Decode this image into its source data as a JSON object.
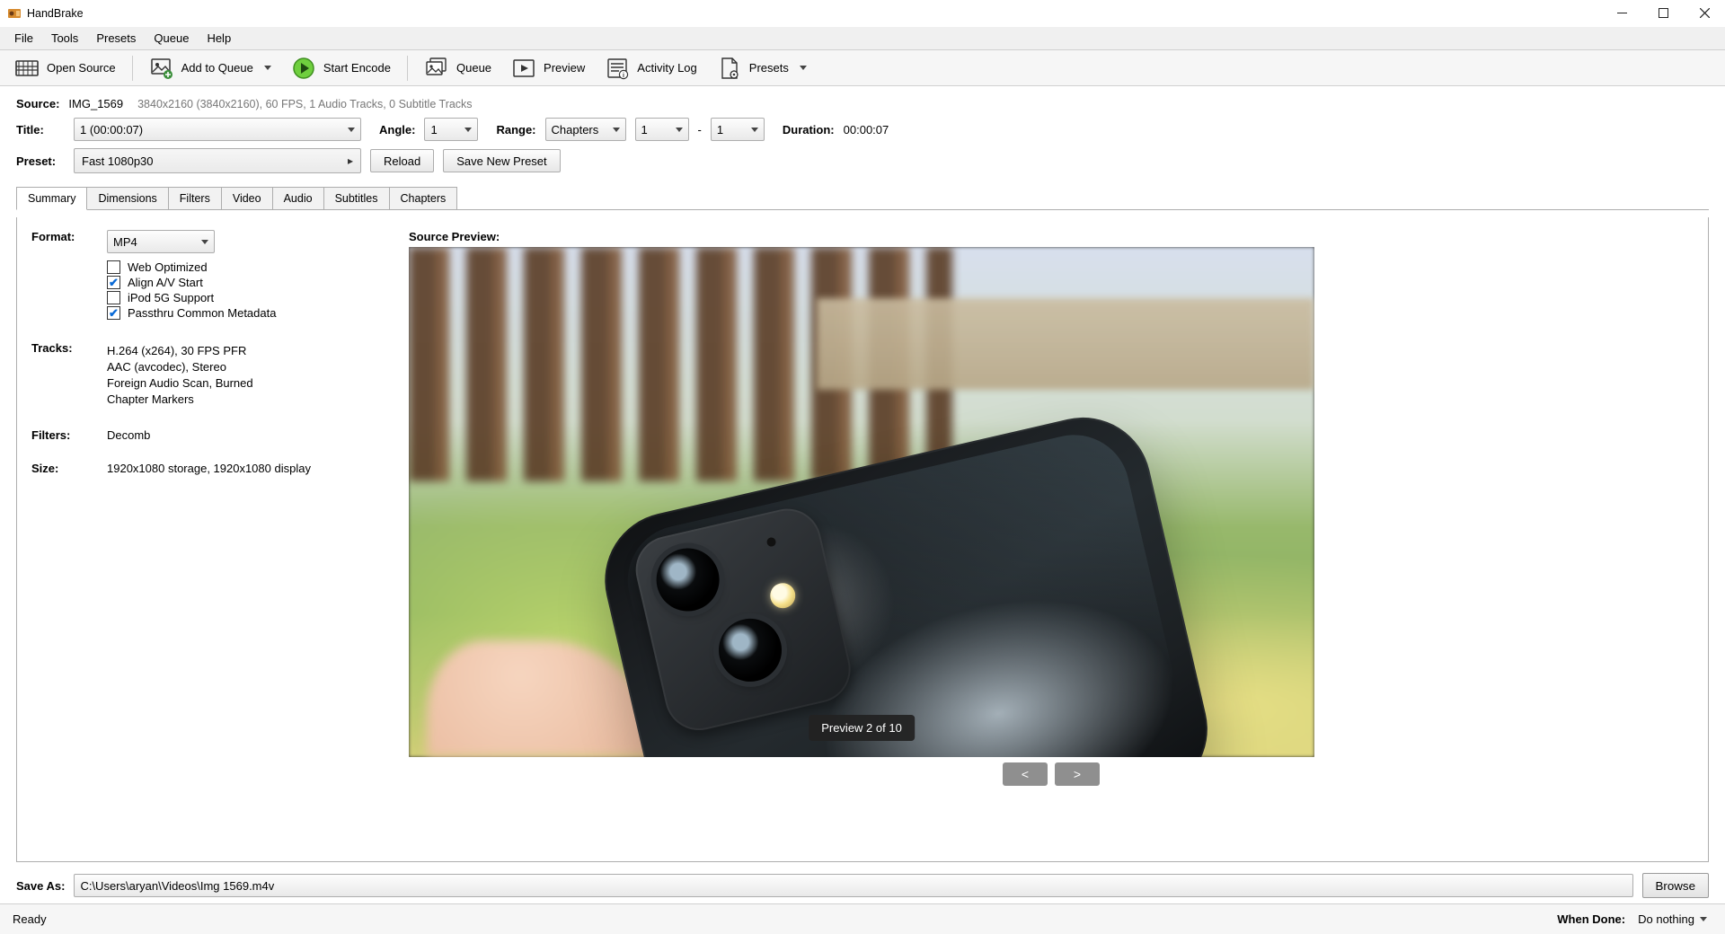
{
  "app": {
    "name": "HandBrake"
  },
  "menubar": {
    "items": [
      "File",
      "Tools",
      "Presets",
      "Queue",
      "Help"
    ]
  },
  "toolbar": {
    "open_source": "Open Source",
    "add_to_queue": "Add to Queue",
    "start_encode": "Start Encode",
    "queue": "Queue",
    "preview": "Preview",
    "activity_log": "Activity Log",
    "presets": "Presets"
  },
  "source_row": {
    "label": "Source:",
    "source_name": "IMG_1569",
    "source_info": "3840x2160 (3840x2160), 60 FPS, 1 Audio Tracks, 0 Subtitle Tracks"
  },
  "title_row": {
    "title_label": "Title:",
    "title_value": "1  (00:00:07)",
    "angle_label": "Angle:",
    "angle_value": "1",
    "range_label": "Range:",
    "range_type": "Chapters",
    "range_from": "1",
    "range_sep": "-",
    "range_to": "1",
    "duration_label": "Duration:",
    "duration_value": "00:00:07"
  },
  "preset_row": {
    "preset_label": "Preset:",
    "preset_value": "Fast 1080p30",
    "reload": "Reload",
    "save_new": "Save New Preset"
  },
  "tabs": {
    "items": [
      "Summary",
      "Dimensions",
      "Filters",
      "Video",
      "Audio",
      "Subtitles",
      "Chapters"
    ],
    "active_index": 0
  },
  "summary": {
    "format_label": "Format:",
    "format_value": "MP4",
    "options": {
      "web_optimized": {
        "label": "Web Optimized",
        "checked": false
      },
      "align_av": {
        "label": "Align A/V Start",
        "checked": true
      },
      "ipod": {
        "label": "iPod 5G Support",
        "checked": false
      },
      "passthru_meta": {
        "label": "Passthru Common Metadata",
        "checked": true
      }
    },
    "tracks_label": "Tracks:",
    "tracks": [
      "H.264 (x264), 30 FPS PFR",
      "AAC (avcodec), Stereo",
      "Foreign Audio Scan, Burned",
      "Chapter Markers"
    ],
    "filters_label": "Filters:",
    "filters_value": "Decomb",
    "size_label": "Size:",
    "size_value": "1920x1080 storage, 1920x1080 display"
  },
  "preview": {
    "title": "Source Preview:",
    "badge": "Preview 2 of 10",
    "prev": "<",
    "next": ">"
  },
  "save": {
    "label": "Save As:",
    "path": "C:\\Users\\aryan\\Videos\\Img 1569.m4v",
    "browse": "Browse"
  },
  "status": {
    "state": "Ready",
    "when_done_label": "When Done:",
    "when_done_value": "Do nothing"
  }
}
